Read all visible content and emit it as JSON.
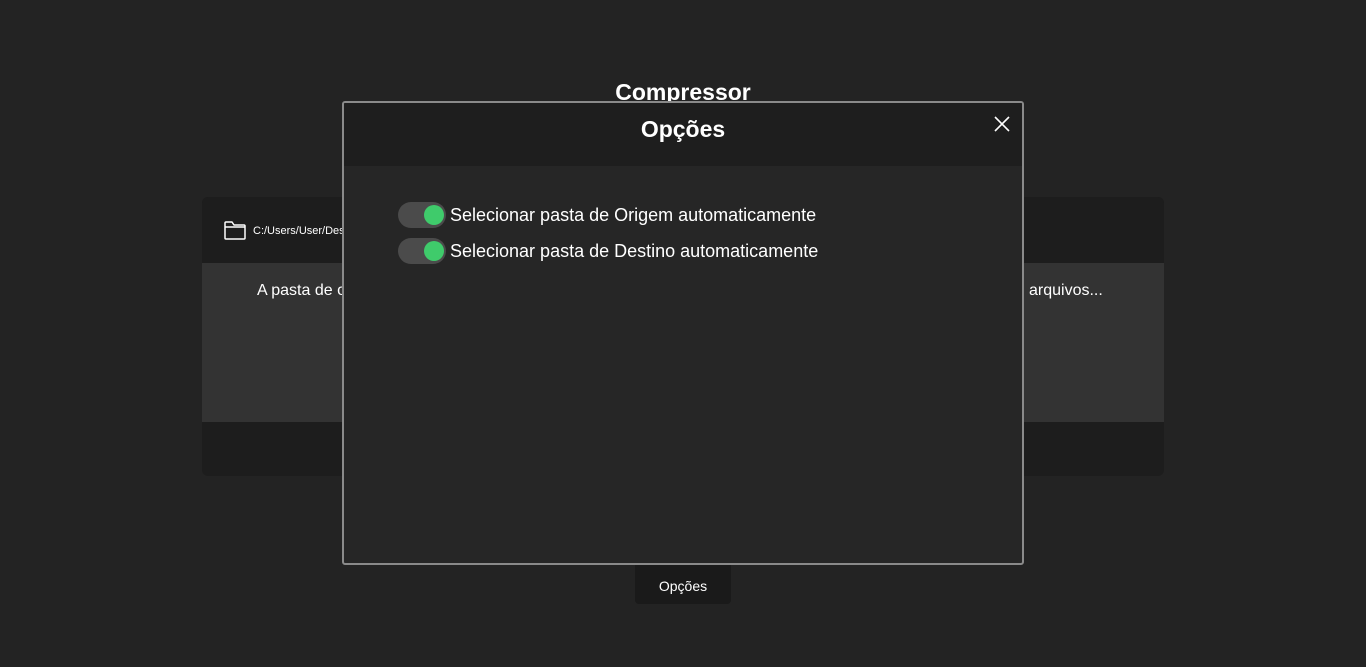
{
  "app": {
    "title": "Compressor"
  },
  "main_card": {
    "path": "C:/Users/User/Des",
    "body_text_left": "A pasta de o",
    "body_text_right": "arquivos..."
  },
  "footer": {
    "options_label": "Opções"
  },
  "modal": {
    "title": "Opções",
    "close_icon": "close-icon",
    "options": [
      {
        "label": "Selecionar pasta de Origem automaticamente",
        "enabled": true
      },
      {
        "label": "Selecionar pasta de Destino automaticamente",
        "enabled": true
      }
    ]
  },
  "colors": {
    "background": "#232323",
    "toggle_on": "#3fcb6b",
    "modal_border": "#8a8a8a"
  }
}
